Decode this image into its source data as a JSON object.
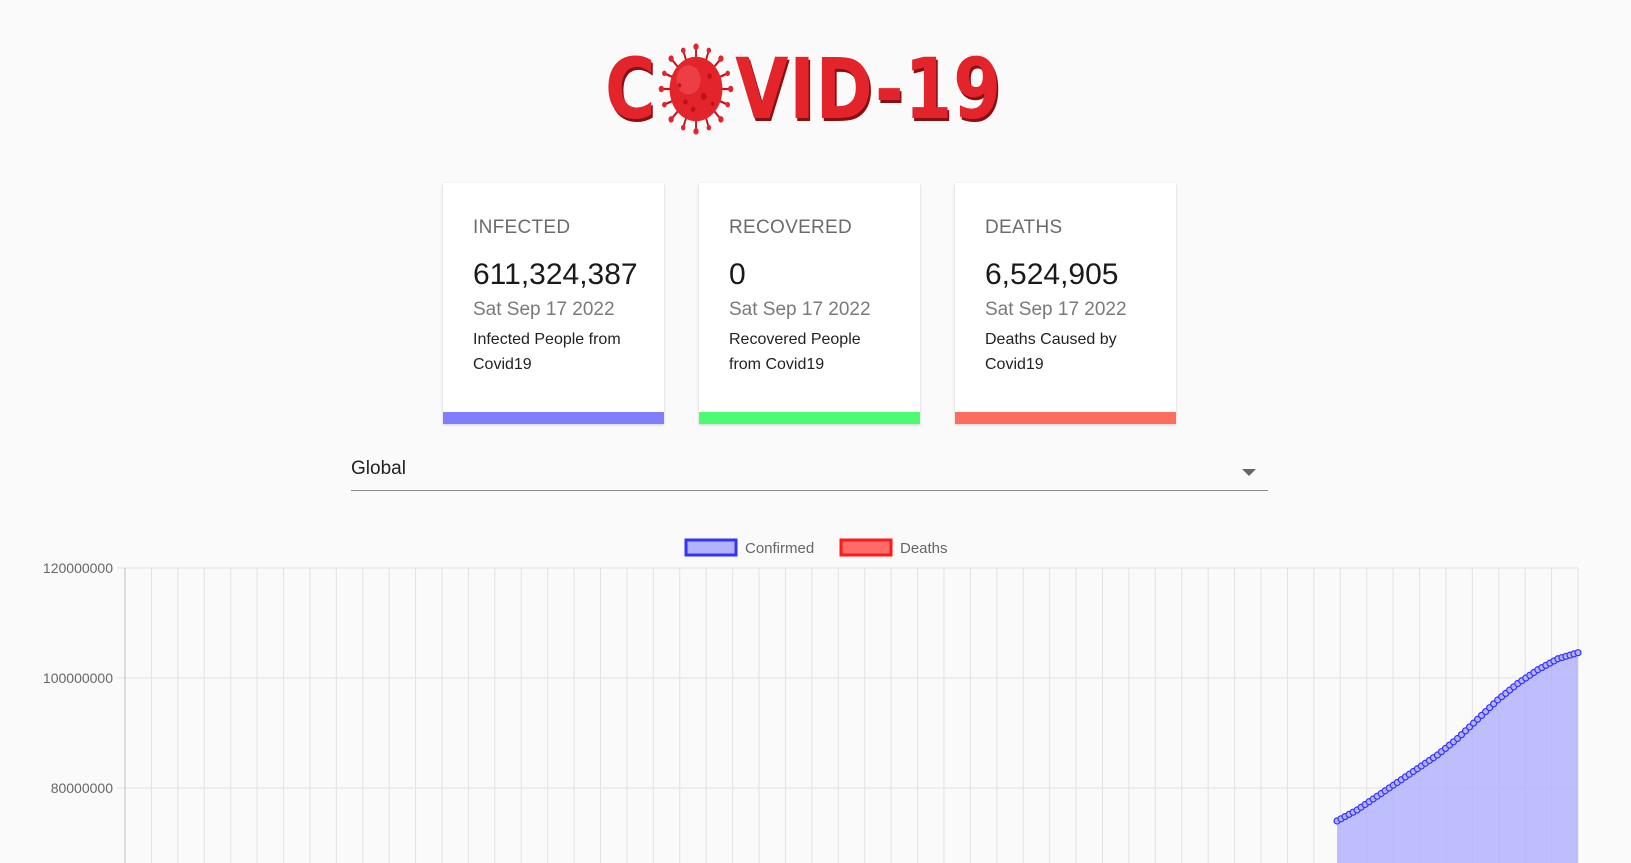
{
  "logo": {
    "left": "C",
    "right": "VID-19"
  },
  "cards": [
    {
      "title": "INFECTED",
      "value": "611,324,387",
      "date": "Sat Sep 17 2022",
      "desc": "Infected People from Covid19",
      "color": "#7f7ffd"
    },
    {
      "title": "RECOVERED",
      "value": "0",
      "date": "Sat Sep 17 2022",
      "desc": "Recovered People from Covid19",
      "color": "#4dfb72"
    },
    {
      "title": "DEATHS",
      "value": "6,524,905",
      "date": "Sat Sep 17 2022",
      "desc": "Deaths Caused by Covid19",
      "color": "#fb6e5d"
    }
  ],
  "country_select": {
    "value": "Global"
  },
  "chart_data": {
    "type": "area",
    "legend": [
      {
        "name": "Confirmed",
        "stroke": "#3333ff",
        "fill": "#b3b3fc"
      },
      {
        "name": "Deaths",
        "stroke": "#ff1a1a",
        "fill": "#ff6b66"
      }
    ],
    "legend_position": "top",
    "y_ticks": [
      "120000000",
      "100000000",
      "80000000"
    ],
    "ylim_visible": [
      70000000,
      120000000
    ],
    "grid": true,
    "series": [
      {
        "name": "Confirmed",
        "values": [
          74000000,
          76000000,
          78500000,
          81000000,
          83500000,
          86000000,
          89000000,
          92500000,
          96000000,
          99000000,
          101500000,
          103500000,
          104600000
        ]
      }
    ]
  }
}
